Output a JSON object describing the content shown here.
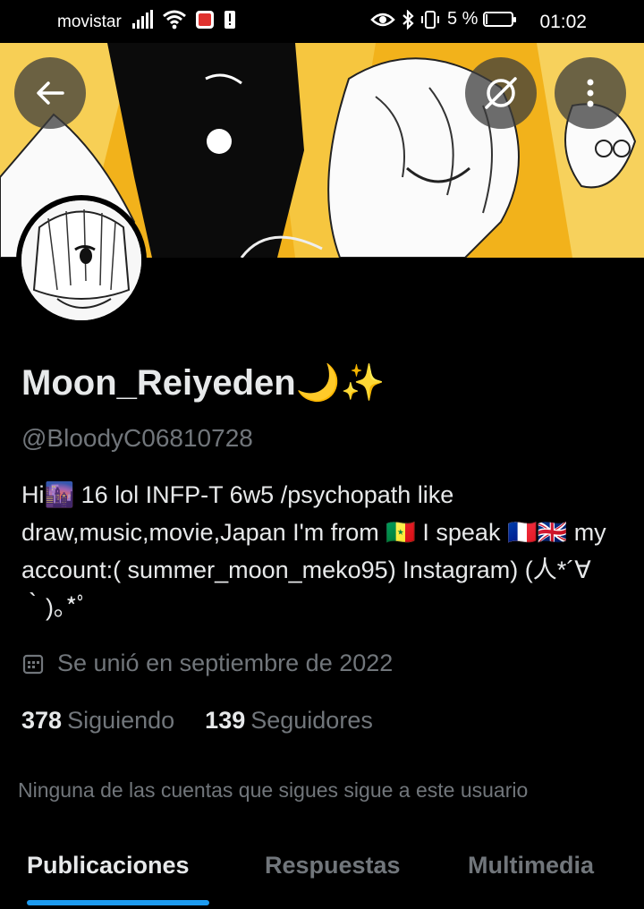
{
  "status_bar": {
    "carrier": "movistar",
    "battery_percent": "5 %",
    "time": "01:02"
  },
  "header": {
    "back_icon": "arrow-left-icon",
    "sync_icon": "sync-off-icon",
    "more_icon": "more-vertical-icon"
  },
  "profile": {
    "display_name": "Moon_Reiyeden🌙✨",
    "handle": "@BloodyC06810728",
    "bio": "Hi🌆 16 lol INFP-T 6w5 /psychopath like draw,music,movie,Japan  I'm from 🇸🇳 I speak 🇫🇷🇬🇧 my account:( summer_moon_meko95) Instagram) (人*´∀｀)｡*ﾟ",
    "joined": "Se unió en septiembre de 2022",
    "following_count": "378",
    "following_label": "Siguiendo",
    "followers_count": "139",
    "followers_label": "Seguidores",
    "mutuals_note": "Ninguna de las cuentas que sigues sigue a este usuario"
  },
  "tabs": [
    {
      "label": "Publicaciones",
      "active": true
    },
    {
      "label": "Respuestas",
      "active": false
    },
    {
      "label": "Multimedia",
      "active": false
    }
  ],
  "colors": {
    "background": "#000000",
    "text_primary": "#e7e9ea",
    "text_secondary": "#71767b",
    "accent": "#1d9bf0",
    "banner_yellow": "#f2b21b"
  }
}
